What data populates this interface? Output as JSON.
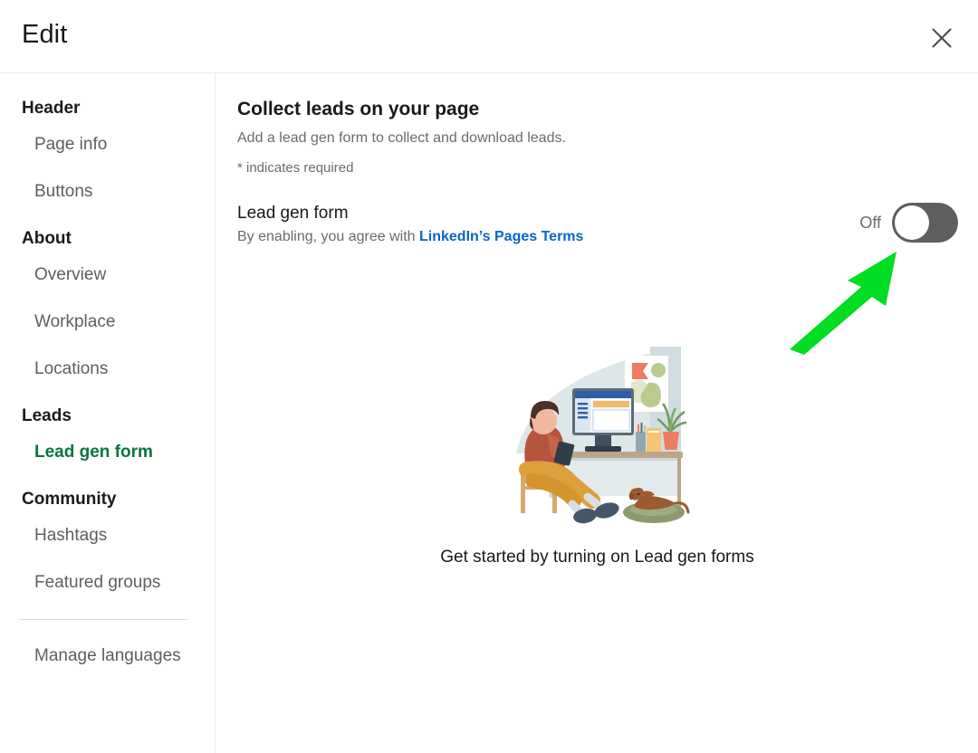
{
  "header": {
    "title": "Edit",
    "close_icon": "close-icon"
  },
  "sidebar": {
    "sections": [
      {
        "title": "Header",
        "items": [
          {
            "label": "Page info",
            "selected": false
          },
          {
            "label": "Buttons",
            "selected": false
          }
        ]
      },
      {
        "title": "About",
        "items": [
          {
            "label": "Overview",
            "selected": false
          },
          {
            "label": "Workplace",
            "selected": false
          },
          {
            "label": "Locations",
            "selected": false
          }
        ]
      },
      {
        "title": "Leads",
        "items": [
          {
            "label": "Lead gen form",
            "selected": true
          }
        ]
      },
      {
        "title": "Community",
        "items": [
          {
            "label": "Hashtags",
            "selected": false
          },
          {
            "label": "Featured groups",
            "selected": false
          }
        ]
      }
    ],
    "footer_item": {
      "label": "Manage languages"
    }
  },
  "main": {
    "title": "Collect leads on your page",
    "subtitle": "Add a lead gen form to collect and download leads.",
    "required_note": "* indicates required",
    "toggle": {
      "label": "Lead gen form",
      "terms_prefix": "By enabling, you agree with ",
      "terms_link": "LinkedIn’s Pages Terms",
      "state_label": "Off",
      "enabled": false
    },
    "empty_state": {
      "caption": "Get started by turning on Lead gen forms",
      "illustration_name": "person-at-desk-with-dog-illustration"
    }
  },
  "annotation": {
    "arrow_name": "green-pointer-arrow",
    "arrow_color": "#00dd22",
    "points_to": "lead-gen-form-toggle"
  },
  "colors": {
    "linkedin_green": "#057642",
    "link_blue": "#0a66c2",
    "toggle_track": "#5e5e5e",
    "text_primary": "#191919",
    "text_secondary": "#6b6b6b",
    "divider": "#ebebeb"
  }
}
